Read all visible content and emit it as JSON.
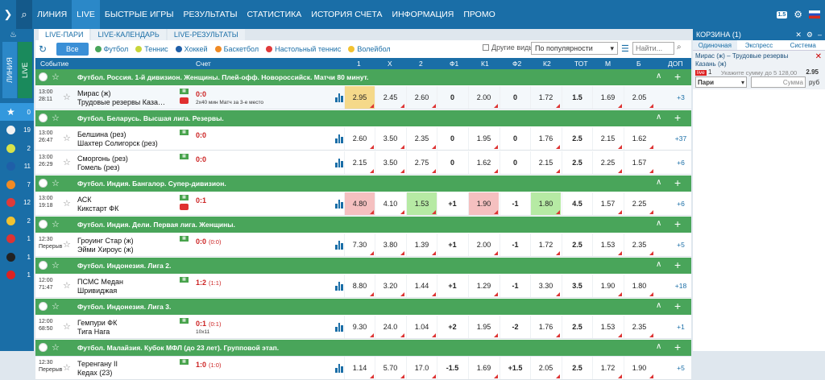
{
  "nav": {
    "items": [
      "ЛИНИЯ",
      "LIVE",
      "БЫСТРЫЕ ИГРЫ",
      "РЕЗУЛЬТАТЫ",
      "СТАТИСТИКА",
      "ИСТОРИЯ СЧЕТА",
      "ИНФОРМАЦИЯ",
      "ПРОМО"
    ],
    "active": 1,
    "badge": "1.5"
  },
  "sidebar": {
    "tab_line": "ЛИНИЯ",
    "tab_live": "LIVE",
    "sports": [
      {
        "icon": "star-icon",
        "count": "0",
        "color": "#ffffff"
      },
      {
        "icon": "football-icon",
        "count": "19",
        "color": "#f2f2f2"
      },
      {
        "icon": "tennis-icon",
        "count": "2",
        "color": "#d8e34a"
      },
      {
        "icon": "hockey-icon",
        "count": "11",
        "color": "#1f5fa8"
      },
      {
        "icon": "basketball-icon",
        "count": "7",
        "color": "#f08a24"
      },
      {
        "icon": "table-tennis-icon",
        "count": "12",
        "color": "#e03a3a"
      },
      {
        "icon": "volleyball-icon",
        "count": "2",
        "color": "#f2c230"
      },
      {
        "icon": "esports-icon",
        "count": "1",
        "color": "#d33"
      },
      {
        "icon": "billiards-icon",
        "count": "1",
        "color": "#222"
      },
      {
        "icon": "darts-icon",
        "count": "1",
        "color": "#d22"
      }
    ]
  },
  "tabs": [
    "LIVE-ПАРИ",
    "LIVE-КАЛЕНДАРЬ",
    "LIVE-РЕЗУЛЬТАТЫ"
  ],
  "filters": {
    "all": "Все",
    "sports": [
      {
        "label": "Футбол",
        "color": "#49a55a"
      },
      {
        "label": "Теннис",
        "color": "#c8d53a"
      },
      {
        "label": "Хоккей",
        "color": "#1f5fa8"
      },
      {
        "label": "Баскетбол",
        "color": "#f08a24"
      },
      {
        "label": "Настольный теннис",
        "color": "#e03a3a"
      },
      {
        "label": "Волейбол",
        "color": "#f2c230"
      }
    ],
    "other": "Другие виды",
    "sort": "По популярности",
    "search_placeholder": "Найти..."
  },
  "headers": {
    "event": "Событие",
    "score": "Счет",
    "cols": [
      "1",
      "X",
      "2",
      "Ф1",
      "К1",
      "Ф2",
      "К2",
      "ТОТ",
      "М",
      "Б",
      "ДОП"
    ]
  },
  "groups": [
    {
      "name": "Футбол. Россия. 1-й дивизион. Женщины. Плей-офф. Новороссийск. Матчи 80 минут.",
      "events": [
        {
          "time": "13:00",
          "clock": "28:11",
          "t1": "Мирас (ж)",
          "t2": "Трудовые резервы Каза…",
          "score": "0:0",
          "sub": "2х40 мин Матч за 3-е место",
          "youtube": true,
          "odds": [
            "2.95",
            "2.45",
            "2.60",
            "0",
            "2.00",
            "0",
            "1.72",
            "1.5",
            "1.69",
            "2.05"
          ],
          "more": "+3",
          "hl": {
            "0": "y"
          },
          "row_lt": true
        }
      ]
    },
    {
      "name": "Футбол. Беларусь. Высшая лига. Резервы.",
      "events": [
        {
          "time": "13:00",
          "clock": "26:47",
          "t1": "Белшина (рез)",
          "t2": "Шахтер Солигорск (рез)",
          "score": "0:0",
          "sub": "",
          "youtube": false,
          "odds": [
            "2.60",
            "3.50",
            "2.35",
            "0",
            "1.95",
            "0",
            "1.76",
            "2.5",
            "2.15",
            "1.62"
          ],
          "more": "+37",
          "hl": {}
        },
        {
          "time": "13:00",
          "clock": "26:29",
          "t1": "Сморгонь (рез)",
          "t2": "Гомель (рез)",
          "score": "0:0",
          "sub": "",
          "youtube": false,
          "odds": [
            "2.15",
            "3.50",
            "2.75",
            "0",
            "1.62",
            "0",
            "2.15",
            "2.5",
            "2.25",
            "1.57"
          ],
          "more": "+6",
          "hl": {}
        }
      ]
    },
    {
      "name": "Футбол. Индия. Бангалор. Супер-дивизион.",
      "events": [
        {
          "time": "13:00",
          "clock": "19:18",
          "t1": "АСК",
          "t2": "Кикстарт ФК",
          "score": "0:1",
          "sub": "",
          "youtube": true,
          "odds": [
            "4.80",
            "4.10",
            "1.53",
            "+1",
            "1.90",
            "-1",
            "1.80",
            "4.5",
            "1.57",
            "2.25"
          ],
          "more": "+6",
          "hl": {
            "0": "r",
            "2": "g",
            "4": "r",
            "6": "g"
          }
        }
      ]
    },
    {
      "name": "Футбол. Индия. Дели. Первая лига. Женщины.",
      "events": [
        {
          "time": "12:30",
          "clock": "Перерыв",
          "t1": "Гроуинг Стар (ж)",
          "t2": "Эйми Хироус (ж)",
          "score": "0:0",
          "scorex": "(0:0)",
          "sub": "",
          "youtube": false,
          "odds": [
            "7.30",
            "3.80",
            "1.39",
            "+1",
            "2.00",
            "-1",
            "1.72",
            "2.5",
            "1.53",
            "2.35"
          ],
          "more": "+5",
          "hl": {}
        }
      ]
    },
    {
      "name": "Футбол. Индонезия. Лига 2.",
      "events": [
        {
          "time": "12:00",
          "clock": "71:47",
          "t1": "ПСМС Медан",
          "t2": "Шривиджая",
          "score": "1:2",
          "scorex": "(1:1)",
          "sub": "",
          "youtube": false,
          "odds": [
            "8.80",
            "3.20",
            "1.44",
            "+1",
            "1.29",
            "-1",
            "3.30",
            "3.5",
            "1.90",
            "1.80"
          ],
          "more": "+18",
          "hl": {}
        }
      ]
    },
    {
      "name": "Футбол. Индонезия. Лига 3.",
      "events": [
        {
          "time": "12:00",
          "clock": "68:50",
          "t1": "Гемпури ФК",
          "t2": "Тига Нага",
          "score": "0:1",
          "scorex": "(0:1)",
          "sub": "10x11",
          "youtube": false,
          "odds": [
            "9.30",
            "24.0",
            "1.04",
            "+2",
            "1.95",
            "-2",
            "1.76",
            "2.5",
            "1.53",
            "2.35"
          ],
          "more": "+1",
          "hl": {}
        }
      ]
    },
    {
      "name": "Футбол. Малайзия. Кубок МФЛ (до 23 лет). Групповой этап.",
      "events": [
        {
          "time": "12:30",
          "clock": "Перерыв",
          "t1": "Теренгану II",
          "t2": "Кедах (23)",
          "score": "1:0",
          "scorex": "(1:0)",
          "sub": "",
          "youtube": false,
          "odds": [
            "1.14",
            "5.70",
            "17.0",
            "-1.5",
            "1.69",
            "+1.5",
            "2.05",
            "2.5",
            "1.72",
            "1.90"
          ],
          "more": "+5",
          "hl": {}
        }
      ]
    }
  ],
  "cart": {
    "title": "КОРЗИНА (1)",
    "tabs": [
      "Одиночная",
      "Экспресс",
      "Система"
    ],
    "event": "Мирас (ж) – Трудовые резервы Казань (ж)",
    "live": "live",
    "outcome": "1",
    "odd": "2.95",
    "type": "Пари",
    "sum_placeholder": "Сумма",
    "currency": "руб",
    "hint": "Укажите сумму до 5 128,00"
  }
}
